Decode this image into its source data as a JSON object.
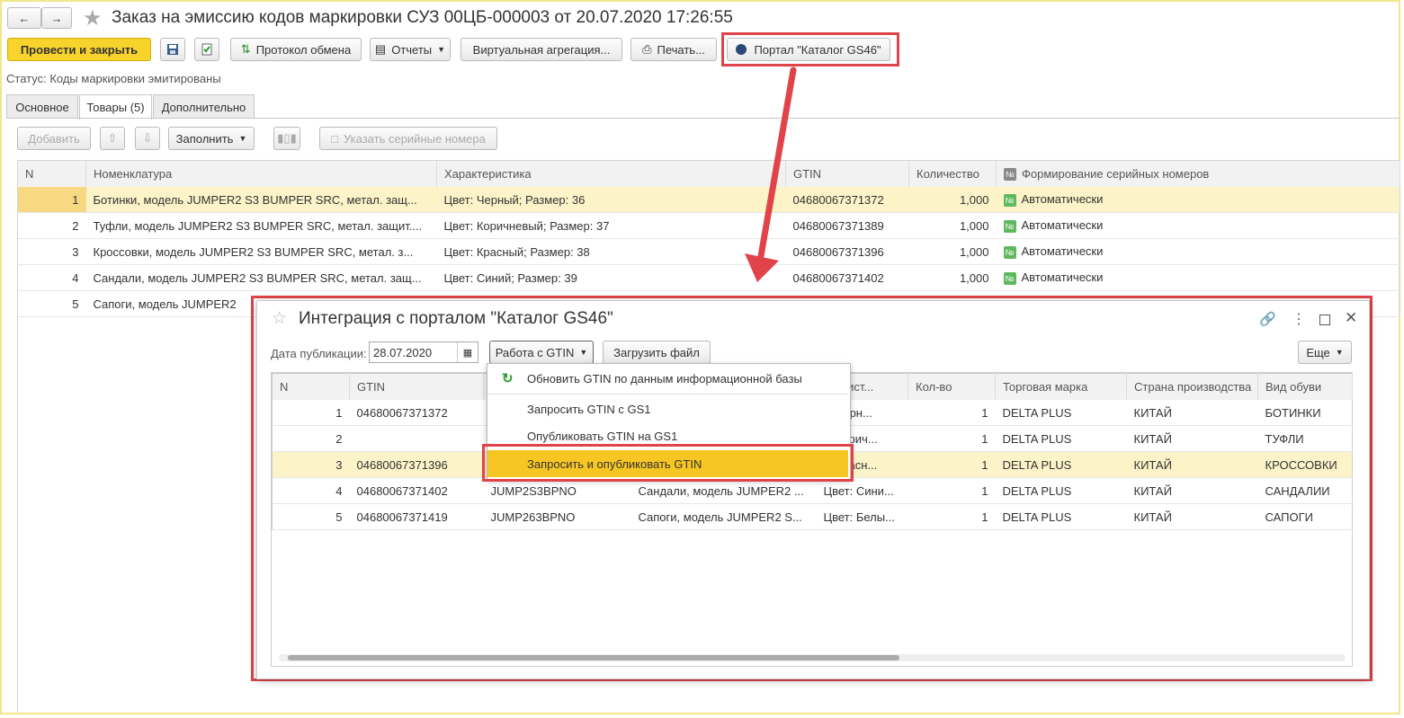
{
  "window": {
    "title": "Заказ на эмиссию кодов маркировки СУЗ 00ЦБ-000003 от 20.07.2020 17:26:55"
  },
  "toolbar": {
    "post_close": "Провести и закрыть",
    "exchange_log": "Протокол обмена",
    "reports": "Отчеты",
    "virtual_aggregation": "Виртуальная агрегация...",
    "print": "Печать...",
    "portal": "Портал \"Каталог GS46\""
  },
  "status": "Статус: Коды маркировки эмитированы",
  "tabs": [
    "Основное",
    "Товары (5)",
    "Дополнительно"
  ],
  "items_toolbar": {
    "add": "Добавить",
    "fill": "Заполнить",
    "serials": "Указать серийные номера"
  },
  "main_table": {
    "columns": [
      "N",
      "Номенклатура",
      "Характеристика",
      "GTIN",
      "Количество",
      "Формирование серийных номеров"
    ],
    "rows": [
      {
        "n": "1",
        "name": "Ботинки, модель JUMPER2 S3 BUMPER SRC,  метал. защ...",
        "char": "Цвет: Черный; Размер: 36",
        "gtin": "04680067371372",
        "qty": "1,000",
        "mode": "Автоматически"
      },
      {
        "n": "2",
        "name": "Туфли, модель JUMPER2 S3 BUMPER SRC,  метал. защит....",
        "char": "Цвет: Коричневый; Размер: 37",
        "gtin": "04680067371389",
        "qty": "1,000",
        "mode": "Автоматически"
      },
      {
        "n": "3",
        "name": "Кроссовки, модель JUMPER2 S3 BUMPER SRC,   метал. з...",
        "char": "Цвет: Красный; Размер: 38",
        "gtin": "04680067371396",
        "qty": "1,000",
        "mode": "Автоматически"
      },
      {
        "n": "4",
        "name": "Сандали, модель JUMPER2 S3 BUMPER SRC,  метал. защ...",
        "char": "Цвет: Синий; Размер: 39",
        "gtin": "04680067371402",
        "qty": "1,000",
        "mode": "Автоматически"
      },
      {
        "n": "5",
        "name": "Сапоги, модель JUMPER2",
        "char": "",
        "gtin": "",
        "qty": "",
        "mode": ""
      }
    ]
  },
  "dialog": {
    "title": "Интеграция с порталом \"Каталог GS46\"",
    "date_label": "Дата публикации:",
    "date_value": "28.07.2020",
    "gtin_menu": "Работа с GTIN",
    "upload": "Загрузить файл",
    "more": "Еще",
    "columns": [
      "N",
      "GTIN",
      "",
      "",
      "ктерист...",
      "Кол-во",
      "Торговая марка",
      "Страна производства",
      "Вид обуви"
    ],
    "rows": [
      {
        "n": "1",
        "gtin": "04680067371372",
        "art": "",
        "name": "",
        "char": "т: Черн...",
        "qty": "1",
        "brand": "DELTA PLUS",
        "country": "КИТАЙ",
        "kind": "БОТИНКИ"
      },
      {
        "n": "2",
        "gtin": "",
        "art": "",
        "name": "",
        "char": "т: Корич...",
        "qty": "1",
        "brand": "DELTA PLUS",
        "country": "КИТАЙ",
        "kind": "ТУФЛИ"
      },
      {
        "n": "3",
        "gtin": "04680067371396",
        "art": "",
        "name": "",
        "char": "т: Красн...",
        "qty": "1",
        "brand": "DELTA PLUS",
        "country": "КИТАЙ",
        "kind": "КРОССОВКИ"
      },
      {
        "n": "4",
        "gtin": "04680067371402",
        "art": "JUMP2S3BPNO",
        "name": "Сандали, модель JUMPER2 ...",
        "char": "Цвет: Сини...",
        "qty": "1",
        "brand": "DELTA PLUS",
        "country": "КИТАЙ",
        "kind": "САНДАЛИИ"
      },
      {
        "n": "5",
        "gtin": "04680067371419",
        "art": "JUMP263BPNO",
        "name": "Сапоги, модель JUMPER2 S...",
        "char": "Цвет: Белы...",
        "qty": "1",
        "brand": "DELTA PLUS",
        "country": "КИТАЙ",
        "kind": "САПОГИ"
      }
    ],
    "menu_items": [
      "Обновить GTIN по данным информационной базы",
      "Запросить GTIN с GS1",
      "Опубликовать GTIN на GS1",
      "Запросить и опубликовать GTIN"
    ]
  },
  "colors": {
    "accent_yellow": "#f7d32c",
    "highlight_red": "#e0444a",
    "selected_row": "#fcf3c8",
    "badge_green": "#5fb85f"
  }
}
